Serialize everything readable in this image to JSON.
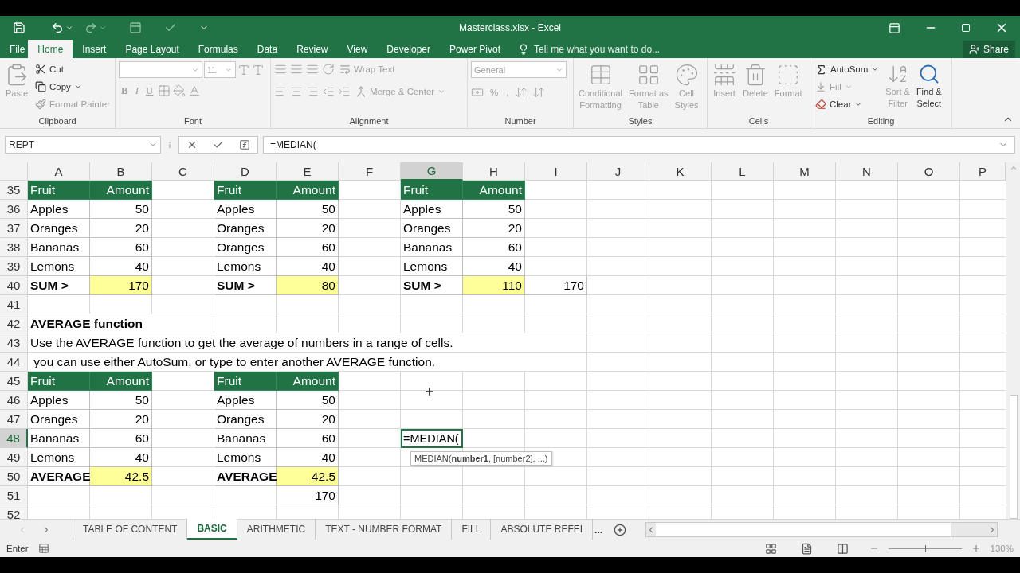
{
  "window": {
    "title": "Masterclass.xlsx - Excel"
  },
  "ribbon_tabs": [
    {
      "label": "File",
      "selected": false
    },
    {
      "label": "Home",
      "selected": true
    },
    {
      "label": "Insert",
      "selected": false
    },
    {
      "label": "Page Layout",
      "selected": false
    },
    {
      "label": "Formulas",
      "selected": false
    },
    {
      "label": "Data",
      "selected": false
    },
    {
      "label": "Review",
      "selected": false
    },
    {
      "label": "View",
      "selected": false
    },
    {
      "label": "Developer",
      "selected": false
    },
    {
      "label": "Power Pivot",
      "selected": false
    }
  ],
  "tell_me": {
    "placeholder": "Tell me what you want to do..."
  },
  "share": "Share",
  "ribbon": [
    {
      "kind": "clipboard",
      "label": "Clipboard",
      "items": [
        {
          "label": "Paste",
          "disabled": true
        },
        {
          "label": "Cut",
          "disabled": false
        },
        {
          "label": "Copy",
          "disabled": false
        },
        {
          "label": "Format Painter",
          "disabled": true
        }
      ]
    },
    {
      "kind": "font",
      "label": "Font",
      "size": "11",
      "items": [
        {
          "label": "B"
        },
        {
          "label": "I"
        },
        {
          "label": "U"
        }
      ]
    },
    {
      "kind": "alignment",
      "label": "Alignment",
      "items": [
        {
          "label": "Wrap Text"
        },
        {
          "label": "Merge & Center"
        }
      ]
    },
    {
      "kind": "number",
      "label": "Number",
      "format": "General",
      "items": [
        {
          "label": "%"
        },
        {
          "label": ","
        }
      ]
    },
    {
      "kind": "styles",
      "label": "Styles",
      "items": [
        {
          "lines": [
            "Conditional",
            "Formatting"
          ]
        },
        {
          "lines": [
            "Format as",
            "Table"
          ]
        },
        {
          "lines": [
            "Cell",
            "Styles"
          ]
        }
      ]
    },
    {
      "kind": "cells",
      "label": "Cells",
      "items": [
        {
          "lines": [
            "Insert"
          ]
        },
        {
          "lines": [
            "Delete"
          ]
        },
        {
          "lines": [
            "Format"
          ]
        }
      ]
    },
    {
      "kind": "editing",
      "label": "Editing",
      "items": [
        {
          "label": "AutoSum",
          "disabled": false
        },
        {
          "label": "Fill",
          "disabled": true
        },
        {
          "label": "Clear",
          "disabled": false
        },
        {
          "lines": [
            "Sort &",
            "Filter"
          ],
          "disabled": true
        },
        {
          "lines": [
            "Find &",
            "Select"
          ],
          "disabled": false
        }
      ]
    }
  ],
  "formula_bar": {
    "name_box": "REPT",
    "formula": "=MEDIAN("
  },
  "columns": [
    {
      "label": "A",
      "selected": false
    },
    {
      "label": "B",
      "selected": false
    },
    {
      "label": "C",
      "selected": false
    },
    {
      "label": "D",
      "selected": false
    },
    {
      "label": "E",
      "selected": false
    },
    {
      "label": "F",
      "selected": false
    },
    {
      "label": "G",
      "selected": true
    },
    {
      "label": "H",
      "selected": false
    },
    {
      "label": "I",
      "selected": false
    },
    {
      "label": "J",
      "selected": false
    },
    {
      "label": "K",
      "selected": false
    },
    {
      "label": "L",
      "selected": false
    },
    {
      "label": "M",
      "selected": false
    },
    {
      "label": "N",
      "selected": false
    },
    {
      "label": "O",
      "selected": false
    },
    {
      "label": "P",
      "selected": false
    }
  ],
  "rows": [
    {
      "number": "35",
      "selected": false,
      "cells": [
        {
          "kind": "head",
          "text": "Fruit"
        },
        {
          "kind": "head-num",
          "text": "Amount"
        },
        {
          "kind": "blank"
        },
        {
          "kind": "head",
          "text": "Fruit"
        },
        {
          "kind": "head-num",
          "text": "Amount"
        },
        {
          "kind": "blank"
        },
        {
          "kind": "head",
          "text": "Fruit"
        },
        {
          "kind": "head-num",
          "text": "Amount"
        }
      ]
    },
    {
      "number": "36",
      "selected": false,
      "cells": [
        {
          "kind": "text",
          "text": "Apples"
        },
        {
          "kind": "num",
          "text": "50"
        },
        {
          "kind": "blank"
        },
        {
          "kind": "text",
          "text": "Apples"
        },
        {
          "kind": "num",
          "text": "50"
        },
        {
          "kind": "blank"
        },
        {
          "kind": "text",
          "text": "Apples"
        },
        {
          "kind": "num",
          "text": "50"
        }
      ]
    },
    {
      "number": "37",
      "selected": false,
      "cells": [
        {
          "kind": "text",
          "text": "Oranges"
        },
        {
          "kind": "num",
          "text": "20"
        },
        {
          "kind": "blank"
        },
        {
          "kind": "text",
          "text": "Oranges"
        },
        {
          "kind": "num",
          "text": "20"
        },
        {
          "kind": "blank"
        },
        {
          "kind": "text",
          "text": "Oranges"
        },
        {
          "kind": "num",
          "text": "20"
        }
      ]
    },
    {
      "number": "38",
      "selected": false,
      "cells": [
        {
          "kind": "text",
          "text": "Bananas"
        },
        {
          "kind": "num",
          "text": "60"
        },
        {
          "kind": "blank"
        },
        {
          "kind": "text",
          "text": "Oranges"
        },
        {
          "kind": "num",
          "text": "60"
        },
        {
          "kind": "blank"
        },
        {
          "kind": "text",
          "text": "Bananas"
        },
        {
          "kind": "num",
          "text": "60"
        }
      ]
    },
    {
      "number": "39",
      "selected": false,
      "cells": [
        {
          "kind": "text",
          "text": "Lemons"
        },
        {
          "kind": "num",
          "text": "40"
        },
        {
          "kind": "blank"
        },
        {
          "kind": "text",
          "text": "Lemons"
        },
        {
          "kind": "num",
          "text": "40"
        },
        {
          "kind": "blank"
        },
        {
          "kind": "text",
          "text": "Lemons"
        },
        {
          "kind": "num",
          "text": "40"
        }
      ]
    },
    {
      "number": "40",
      "selected": false,
      "cells": [
        {
          "kind": "bold",
          "text": "SUM >"
        },
        {
          "kind": "total",
          "text": "170"
        },
        {
          "kind": "blank"
        },
        {
          "kind": "bold",
          "text": "SUM >"
        },
        {
          "kind": "total",
          "text": "80"
        },
        {
          "kind": "blank"
        },
        {
          "kind": "bold",
          "text": "SUM >"
        },
        {
          "kind": "total",
          "text": "110"
        },
        {
          "kind": "num",
          "text": "170"
        }
      ]
    },
    {
      "number": "41",
      "selected": false,
      "cells": []
    },
    {
      "number": "42",
      "selected": false,
      "cells": [
        {
          "kind": "title",
          "text": "AVERAGE function"
        }
      ]
    },
    {
      "number": "43",
      "selected": false,
      "cells": [
        {
          "kind": "note",
          "text": "Use the AVERAGE function to get the average of numbers in a range of cells."
        }
      ]
    },
    {
      "number": "44",
      "selected": false,
      "cells": [
        {
          "kind": "note",
          "text": " you can use either AutoSum, or type to enter another AVERAGE function."
        }
      ]
    },
    {
      "number": "45",
      "selected": false,
      "cells": [
        {
          "kind": "head",
          "text": "Fruit"
        },
        {
          "kind": "head-num",
          "text": "Amount"
        },
        {
          "kind": "blank"
        },
        {
          "kind": "head",
          "text": "Fruit"
        },
        {
          "kind": "head-num",
          "text": "Amount"
        }
      ]
    },
    {
      "number": "46",
      "selected": false,
      "cells": [
        {
          "kind": "text",
          "text": "Apples"
        },
        {
          "kind": "num",
          "text": "50"
        },
        {
          "kind": "blank"
        },
        {
          "kind": "text",
          "text": "Apples"
        },
        {
          "kind": "num",
          "text": "50"
        }
      ]
    },
    {
      "number": "47",
      "selected": false,
      "cells": [
        {
          "kind": "text",
          "text": "Oranges"
        },
        {
          "kind": "num",
          "text": "20"
        },
        {
          "kind": "blank"
        },
        {
          "kind": "text",
          "text": "Oranges"
        },
        {
          "kind": "num",
          "text": "20"
        }
      ]
    },
    {
      "number": "48",
      "selected": true,
      "cells": [
        {
          "kind": "text",
          "text": "Bananas"
        },
        {
          "kind": "num",
          "text": "60"
        },
        {
          "kind": "blank"
        },
        {
          "kind": "text",
          "text": "Bananas"
        },
        {
          "kind": "num",
          "text": "60"
        },
        {
          "kind": "blank"
        },
        {
          "kind": "edit",
          "text": "=MEDIAN(",
          "tooltip": "MEDIAN(**number1**, [number2], ...)"
        }
      ]
    },
    {
      "number": "49",
      "selected": false,
      "cells": [
        {
          "kind": "text",
          "text": "Lemons"
        },
        {
          "kind": "num",
          "text": "40"
        },
        {
          "kind": "blank"
        },
        {
          "kind": "text",
          "text": "Lemons"
        },
        {
          "kind": "num",
          "text": "40"
        }
      ]
    },
    {
      "number": "50",
      "selected": false,
      "cells": [
        {
          "kind": "bold",
          "text": "AVERAGE"
        },
        {
          "kind": "total",
          "text": "42.5"
        },
        {
          "kind": "blank"
        },
        {
          "kind": "bold",
          "text": "AVERAGE"
        },
        {
          "kind": "total",
          "text": "42.5"
        }
      ]
    },
    {
      "number": "51",
      "selected": false,
      "cells": [
        {
          "kind": "blank"
        },
        {
          "kind": "blank"
        },
        {
          "kind": "blank"
        },
        {
          "kind": "blank"
        },
        {
          "kind": "num",
          "text": "170"
        }
      ]
    },
    {
      "number": "52",
      "selected": false,
      "cells": []
    }
  ],
  "sheet_tabs": [
    {
      "label": "TABLE OF CONTENT",
      "selected": false
    },
    {
      "label": "BASIC",
      "selected": true
    },
    {
      "label": "ARITHMETIC",
      "selected": false
    },
    {
      "label": "TEXT - NUMBER FORMAT",
      "selected": false
    },
    {
      "label": "FILL",
      "selected": false
    },
    {
      "label": "ABSOLUTE REFEI",
      "selected": false
    }
  ],
  "more_sheets": "...",
  "status_bar": {
    "mode": "Enter",
    "zoom": "130%",
    "zoom_level": {
      "level": 0.5
    }
  }
}
